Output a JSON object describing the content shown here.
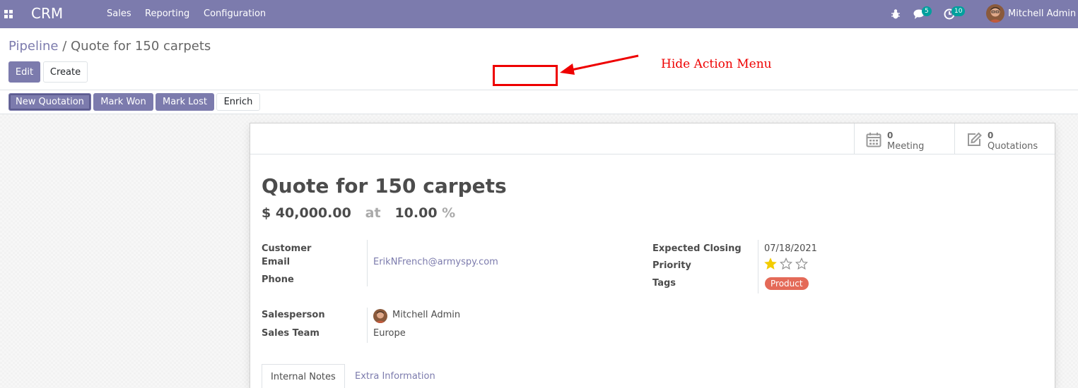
{
  "navbar": {
    "app_name": "CRM",
    "menus": [
      "Sales",
      "Reporting",
      "Configuration"
    ],
    "messages_count": "5",
    "activities_count": "10",
    "user_name": "Mitchell Admin",
    "color": "#7c7bad"
  },
  "breadcrumb": {
    "parent": "Pipeline",
    "separator": "/",
    "current": "Quote for 150 carpets"
  },
  "actions": {
    "edit": "Edit",
    "create": "Create"
  },
  "annotation": {
    "text": "Hide Action Menu",
    "color": "#ee0000"
  },
  "statusbar": {
    "new_quotation": "New Quotation",
    "mark_won": "Mark Won",
    "mark_lost": "Mark Lost",
    "enrich": "Enrich"
  },
  "smart_buttons": {
    "meeting": {
      "value": "0",
      "label": "Meeting",
      "icon": "calendar-icon"
    },
    "quotations": {
      "value": "0",
      "label": "Quotations",
      "icon": "pencil-square-icon"
    }
  },
  "lead": {
    "title": "Quote for 150 carpets",
    "expected_revenue": "$ 40,000.00",
    "at": "at",
    "probability": "10.00",
    "percent_sign": "%"
  },
  "fields": {
    "customer_label": "Customer",
    "email_label": "Email",
    "email_value": "ErikNFrench@armyspy.com",
    "phone_label": "Phone",
    "salesperson_label": "Salesperson",
    "salesperson_value": "Mitchell Admin",
    "sales_team_label": "Sales Team",
    "sales_team_value": "Europe",
    "expected_closing_label": "Expected Closing",
    "expected_closing_value": "07/18/2021",
    "priority_label": "Priority",
    "priority_stars": 1,
    "priority_max": 3,
    "tags_label": "Tags",
    "tag": "Product",
    "tag_color": "#e46a58"
  },
  "tabs": [
    {
      "label": "Internal Notes",
      "active": true
    },
    {
      "label": "Extra Information",
      "active": false
    }
  ]
}
